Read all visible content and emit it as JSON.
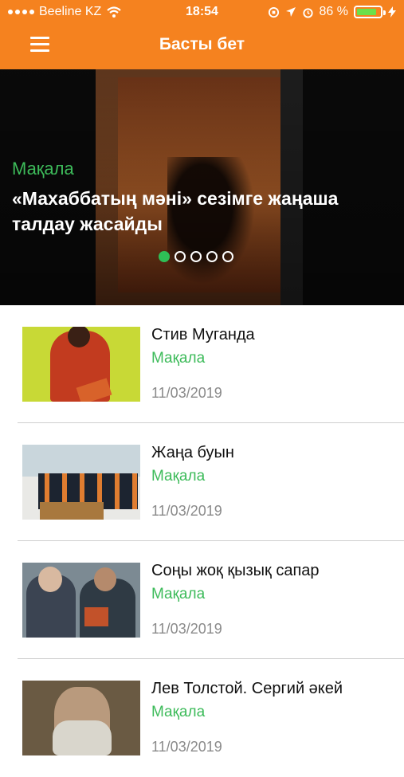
{
  "status_bar": {
    "carrier": "Beeline KZ",
    "time": "18:54",
    "battery_percent": "86 %",
    "battery_level": 0.86,
    "icons": [
      "signal-icon",
      "wifi-icon",
      "rotation-lock-icon",
      "location-icon",
      "alarm-icon",
      "battery-icon",
      "charging-icon"
    ]
  },
  "header": {
    "title": "Басты бет",
    "menu_icon": "hamburger-menu-icon"
  },
  "featured": {
    "category": "Мақала",
    "title": "«Махаббатың мәні» сезімге жаңаша талдау жасайды",
    "slides_total": 5,
    "active_slide": 1
  },
  "articles": [
    {
      "title": "Стив Муганда",
      "category": "Мақала",
      "date": "11/03/2019"
    },
    {
      "title": "Жаңа буын",
      "category": "Мақала",
      "date": "11/03/2019"
    },
    {
      "title": "Соңы жоқ қызық сапар",
      "category": "Мақала",
      "date": "11/03/2019"
    },
    {
      "title": "Лев Толстой. Сергий әкей",
      "category": "Мақала",
      "date": "11/03/2019"
    }
  ],
  "colors": {
    "brand_orange": "#f5821f",
    "accent_green": "#3dbb5a",
    "date_gray": "#8a8a8a"
  }
}
